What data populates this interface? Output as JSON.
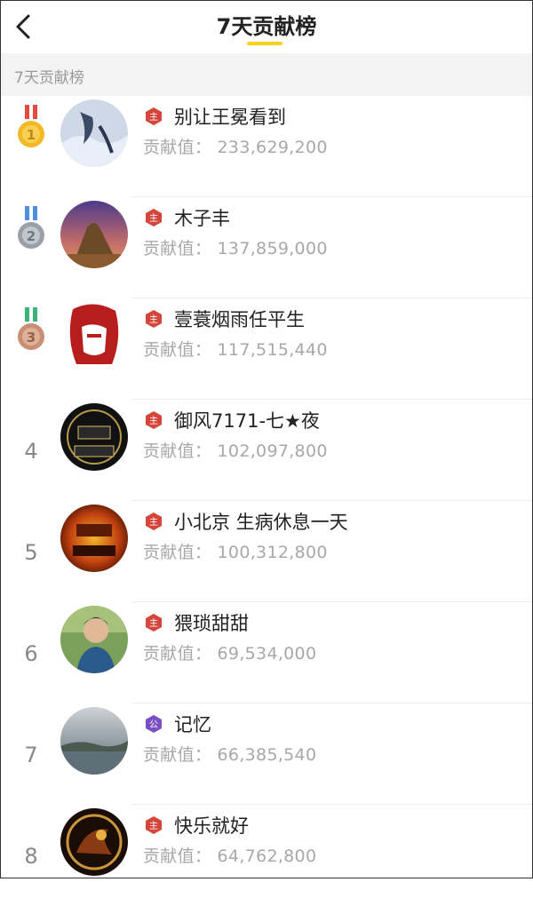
{
  "header": {
    "title": "7天贡献榜"
  },
  "section": {
    "label": "7天贡献榜"
  },
  "contrib_label": "贡献值：",
  "entries": [
    {
      "rank": "1",
      "name": "别让王冕看到",
      "value": "233,629,200",
      "badge": "主",
      "badge_color": "#d4453b",
      "medal": "gold"
    },
    {
      "rank": "2",
      "name": "木子丰",
      "value": "137,859,000",
      "badge": "主",
      "badge_color": "#d4453b",
      "medal": "silver"
    },
    {
      "rank": "3",
      "name": "壹蓑烟雨任平生",
      "value": "117,515,440",
      "badge": "主",
      "badge_color": "#d4453b",
      "medal": "bronze"
    },
    {
      "rank": "4",
      "name": "御风7171-七★夜",
      "value": "102,097,800",
      "badge": "主",
      "badge_color": "#d4453b",
      "medal": ""
    },
    {
      "rank": "5",
      "name": "小北京 生病休息一天",
      "value": "100,312,800",
      "badge": "主",
      "badge_color": "#d4453b",
      "medal": ""
    },
    {
      "rank": "6",
      "name": "猥琐甜甜",
      "value": "69,534,000",
      "badge": "主",
      "badge_color": "#d4453b",
      "medal": ""
    },
    {
      "rank": "7",
      "name": "记忆",
      "value": "66,385,540",
      "badge": "公",
      "badge_color": "#7b4fc4",
      "medal": ""
    },
    {
      "rank": "8",
      "name": "快乐就好",
      "value": "64,762,800",
      "badge": "主",
      "badge_color": "#d4453b",
      "medal": ""
    }
  ],
  "icons": {
    "back": "chevron-left-icon",
    "medal_gold": "gold-medal-icon",
    "medal_silver": "silver-medal-icon",
    "medal_bronze": "bronze-medal-icon"
  },
  "colors": {
    "accent": "#f7d21a",
    "gold": "#f2b826",
    "silver": "#9aa0a8",
    "bronze": "#c98f74"
  }
}
